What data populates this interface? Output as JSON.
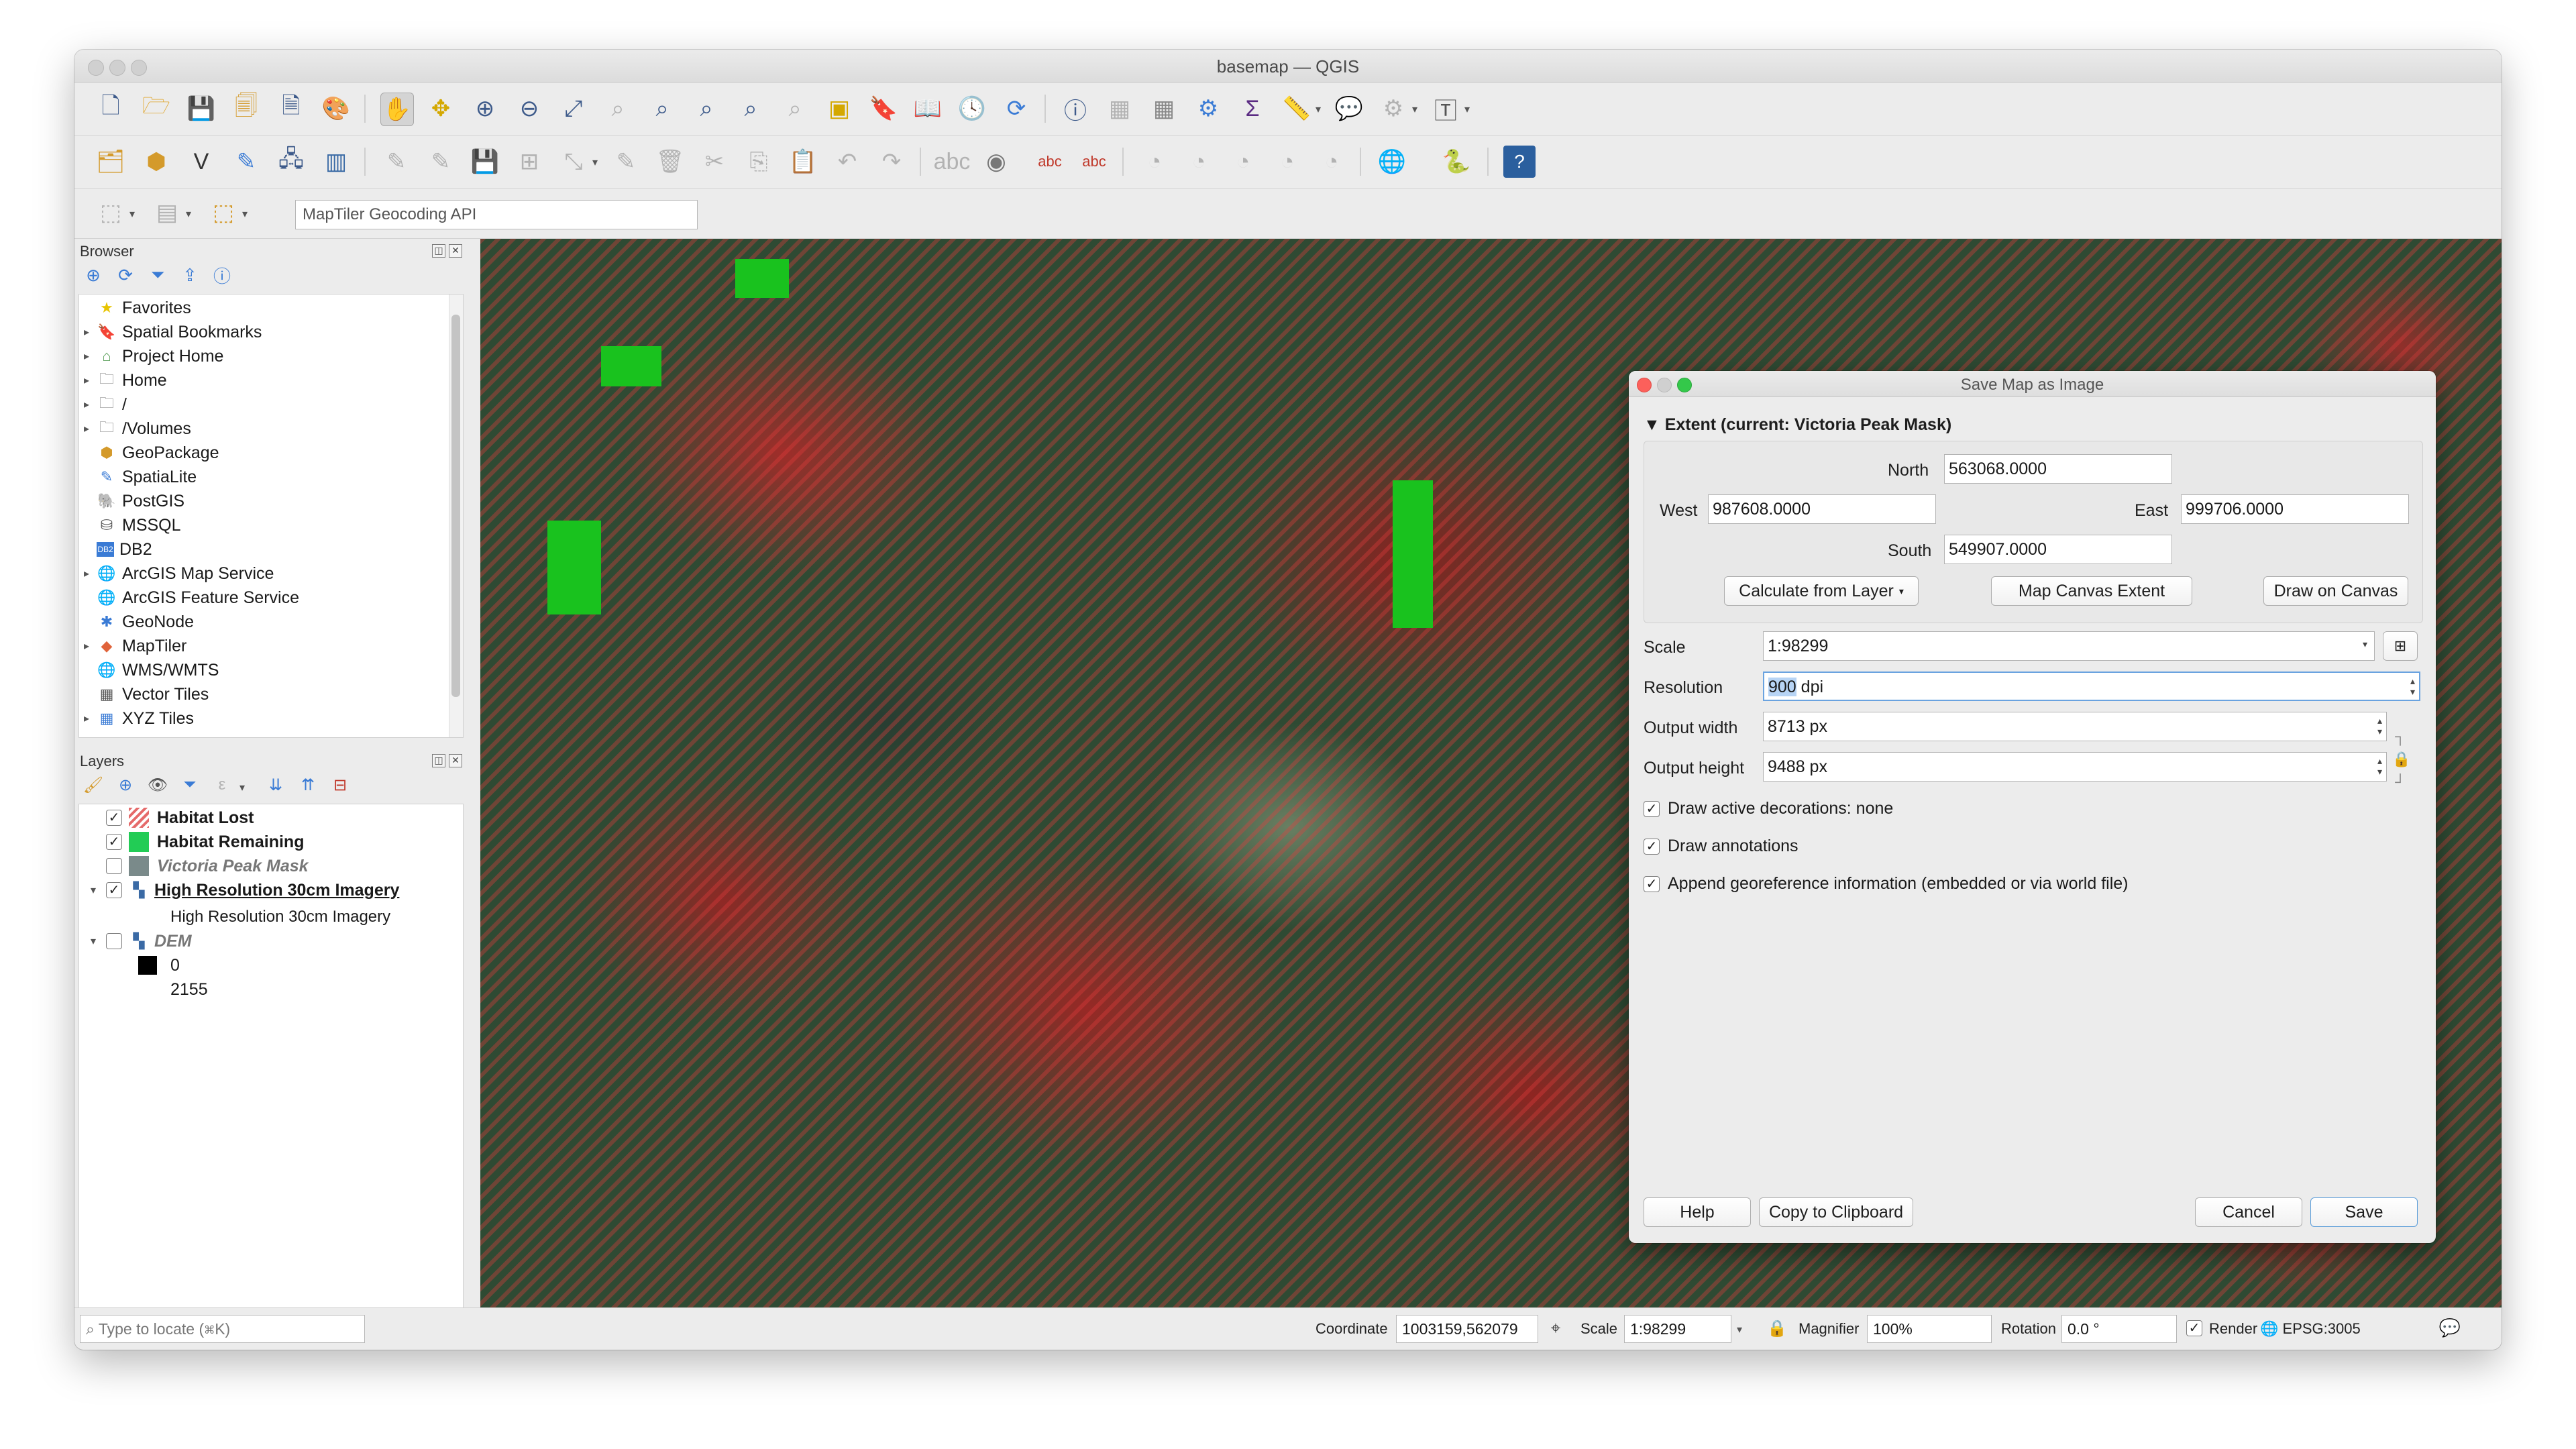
{
  "window": {
    "title": "basemap — QGIS"
  },
  "toolbar3": {
    "geocoder_placeholder": "MapTiler Geocoding API"
  },
  "browser": {
    "title": "Browser",
    "items": [
      {
        "label": "Favorites",
        "icon": "star-icon"
      },
      {
        "label": "Spatial Bookmarks",
        "icon": "bookmark-icon"
      },
      {
        "label": "Project Home",
        "icon": "project-home-icon"
      },
      {
        "label": "Home",
        "icon": "folder-icon"
      },
      {
        "label": "/",
        "icon": "folder-icon"
      },
      {
        "label": "/Volumes",
        "icon": "folder-icon"
      },
      {
        "label": "GeoPackage",
        "icon": "geopackage-icon"
      },
      {
        "label": "SpatiaLite",
        "icon": "spatialite-icon"
      },
      {
        "label": "PostGIS",
        "icon": "postgis-icon"
      },
      {
        "label": "MSSQL",
        "icon": "mssql-icon"
      },
      {
        "label": "DB2",
        "icon": "db2-icon"
      },
      {
        "label": "ArcGIS Map Service",
        "icon": "globe-icon"
      },
      {
        "label": "ArcGIS Feature Service",
        "icon": "globe-icon"
      },
      {
        "label": "GeoNode",
        "icon": "geonode-icon"
      },
      {
        "label": "MapTiler",
        "icon": "maptiler-icon"
      },
      {
        "label": "WMS/WMTS",
        "icon": "globe-icon"
      },
      {
        "label": "Vector Tiles",
        "icon": "grid-icon"
      },
      {
        "label": "XYZ Tiles",
        "icon": "grid-icon"
      }
    ]
  },
  "layers": {
    "title": "Layers",
    "items": [
      {
        "label": "Habitat Lost",
        "checked": true,
        "swatch": "#e56b6b"
      },
      {
        "label": "Habitat Remaining",
        "checked": true,
        "swatch": "#22cc55"
      },
      {
        "label": "Victoria Peak Mask",
        "checked": false,
        "swatch": "#7a8a8a"
      },
      {
        "label": "High Resolution 30cm Imagery",
        "checked": true
      },
      {
        "label": "High Resolution 30cm Imagery"
      },
      {
        "label": "DEM",
        "checked": false
      },
      {
        "label": "0"
      },
      {
        "label": "2155"
      }
    ]
  },
  "dialog": {
    "title": "Save Map as Image",
    "extent_header": "Extent (current: Victoria Peak Mask)",
    "north_label": "North",
    "north_value": "563068.0000",
    "west_label": "West",
    "west_value": "987608.0000",
    "east_label": "East",
    "east_value": "999706.0000",
    "south_label": "South",
    "south_value": "549907.0000",
    "calc_from_layer": "Calculate from Layer",
    "map_canvas_extent": "Map Canvas Extent",
    "draw_on_canvas": "Draw on Canvas",
    "scale_label": "Scale",
    "scale_value": "1:98299",
    "resolution_label": "Resolution",
    "resolution_number": "900",
    "resolution_unit": " dpi",
    "output_width_label": "Output width",
    "output_width_value": "8713 px",
    "output_height_label": "Output height",
    "output_height_value": "9488 px",
    "chk_decorations": "Draw active decorations: none",
    "chk_annotations": "Draw annotations",
    "chk_georef": "Append georeference information (embedded or via world file)",
    "help": "Help",
    "copy": "Copy to Clipboard",
    "cancel": "Cancel",
    "save": "Save"
  },
  "status": {
    "locate_placeholder": "Type to locate (⌘K)",
    "coordinate_label": "Coordinate",
    "coordinate_value": "1003159,562079",
    "scale_label": "Scale",
    "scale_value": "1:98299",
    "magnifier_label": "Magnifier",
    "magnifier_value": "100%",
    "rotation_label": "Rotation",
    "rotation_value": "0.0 °",
    "render_label": "Render",
    "crs": "EPSG:3005"
  }
}
